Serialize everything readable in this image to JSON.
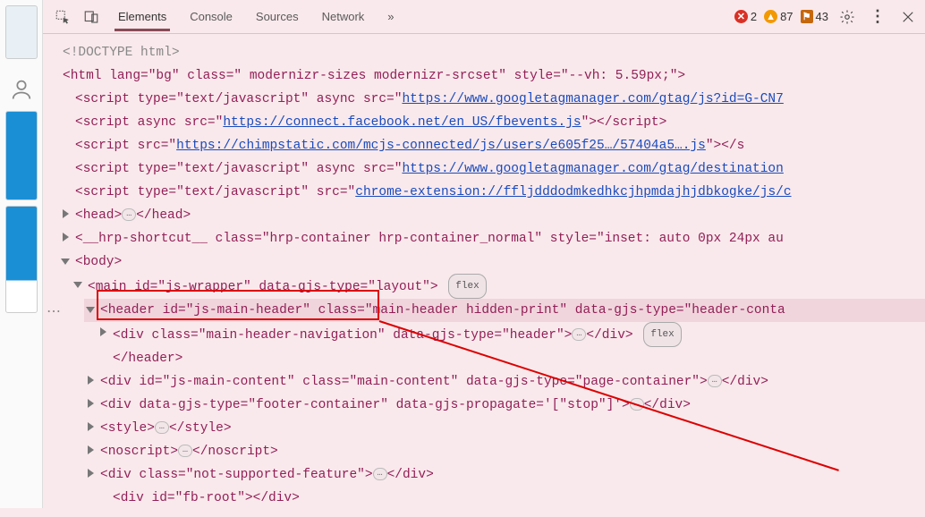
{
  "tabs": {
    "elements": "Elements",
    "console": "Console",
    "sources": "Sources",
    "network": "Network",
    "more": "»"
  },
  "errors": {
    "red": "2",
    "orange": "87",
    "flag": "43"
  },
  "tree": {
    "doctype": "<!DOCTYPE html>",
    "html_open": "<html lang=\"bg\" class=\" modernizr-sizes modernizr-srcset\" style=\"--vh: 5.59px;\">",
    "s1a": "<script type=\"text/javascript\" async src=\"",
    "s1u": "https://www.googletagmanager.com/gtag/js?id=G-CN7",
    "s2a": "<script async src=\"",
    "s2u": "https://connect.facebook.net/en_US/fbevents.js",
    "s2b": "\"></script>",
    "s3a": "<script src=\"",
    "s3u": "https://chimpstatic.com/mcjs-connected/js/users/e605f25…/57404a5….js",
    "s3b": "\"></s",
    "s4a": "<script type=\"text/javascript\" async src=\"",
    "s4u": "https://www.googletagmanager.com/gtag/destination",
    "s5a": "<script type=\"text/javascript\" src=\"",
    "s5u": "chrome-extension://ffljdddodmkedhkcjhpmdajhjdbkogke/js/c",
    "head": "<head>",
    "head_c": "</head>",
    "hrp": "<__hrp-shortcut__ class=\"hrp-container hrp-container_normal\" style=\"inset: auto 0px 24px au",
    "body": "<body>",
    "main": "<main id=\"js-wrapper\" data-gjs-type=\"layout\">",
    "header": "<header id=\"js-main-header\" class=\"main-header hidden-print\" data-gjs-type=\"header-conta",
    "nav": "<div class=\"main-header-navigation\" data-gjs-type=\"header\">",
    "nav_c": "</div>",
    "header_c": "</header>",
    "mc": "<div id=\"js-main-content\" class=\"main-content\" data-gjs-type=\"page-container\">",
    "mc_c": "</div>",
    "ft": "<div data-gjs-type=\"footer-container\" data-gjs-propagate='[\"stop\"]'>",
    "ft_c": "</div>",
    "style": "<style>",
    "style_c": "</style>",
    "ns": "<noscript>",
    "ns_c": "</noscript>",
    "nsf": "<div class=\"not-supported-feature\">",
    "nsf_c": "</div>",
    "fb": "<div id=\"fb-root\"></div>",
    "flex": "flex",
    "dots": "…"
  }
}
